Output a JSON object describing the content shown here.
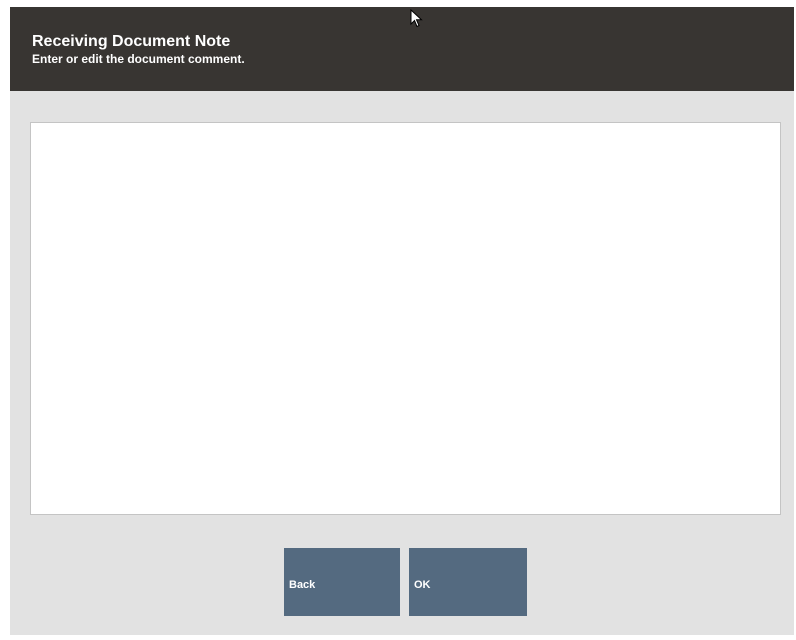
{
  "header": {
    "title": "Receiving Document Note",
    "subtitle": "Enter or edit the document comment."
  },
  "note": {
    "value": ""
  },
  "buttons": {
    "back_label": "Back",
    "ok_label": "OK"
  },
  "colors": {
    "header_bg": "#383532",
    "body_bg": "#e2e2e2",
    "button_bg": "#546a80"
  },
  "icons": {
    "pointer": "mouse-pointer-icon"
  }
}
